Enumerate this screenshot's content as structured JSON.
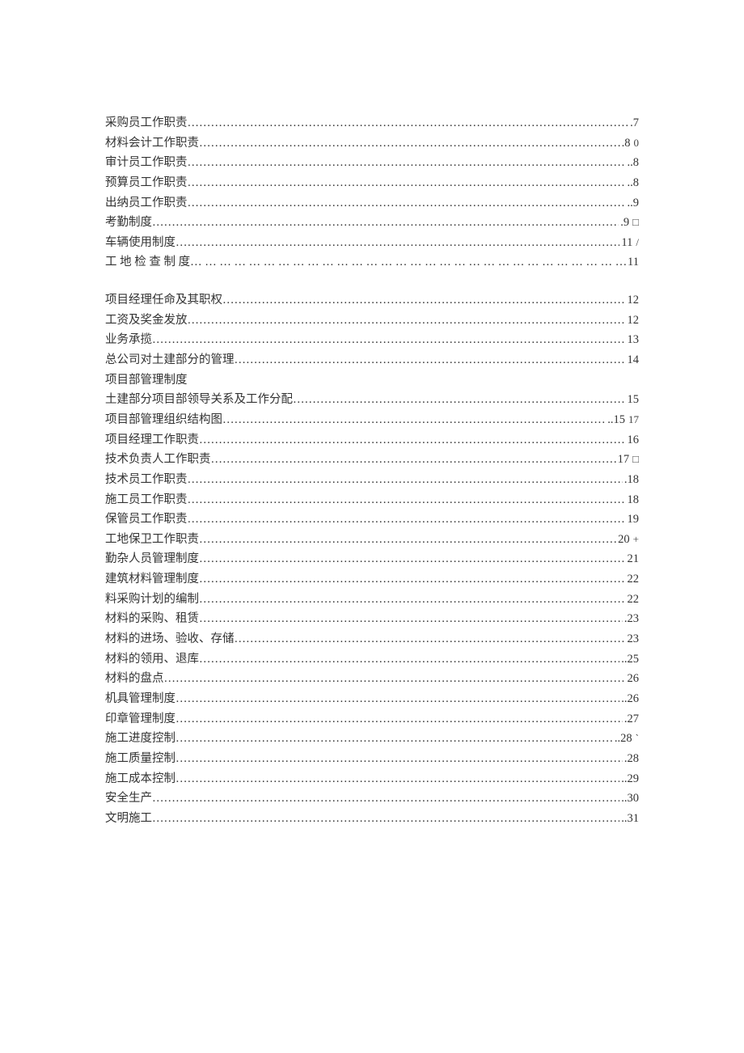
{
  "leader_fill": "……………………………………………………………………………………………………………………………………………………",
  "leader_fill_spaced": "… … … … … … … … … … … … … … … … … … … … … … … … … … … … … … … … … … … … … … … … … … … … … … … … … … … …",
  "block1": [
    {
      "title": "采购员工作职责",
      "page": ".7",
      "trail": ""
    },
    {
      "title": "材料会计工作职责",
      "page": ".8",
      "trail": "0"
    },
    {
      "title": "审计员工作职责",
      "page": "..8",
      "trail": ""
    },
    {
      "title": "预算员工作职责",
      "page": "..8",
      "trail": ""
    },
    {
      "title": "出纳员工作职责",
      "page": "..9",
      "trail": ""
    },
    {
      "title": "考勤制度",
      "page": ".9",
      "trail": "□"
    },
    {
      "title": "车辆使用制度",
      "page": "11",
      "trail": "/"
    },
    {
      "title": "工 地 检 查 制 度",
      "page": "11",
      "trail": "",
      "spaced": true
    }
  ],
  "block2": [
    {
      "title": "项目经理任命及其职权",
      "page": "12",
      "trail": ""
    },
    {
      "title": "工资及奖金发放",
      "page": "12",
      "trail": ""
    },
    {
      "title": "业务承揽",
      "page": "13",
      "trail": ""
    },
    {
      "title": "总公司对土建部分的管理",
      "page": "14",
      "trail": ""
    },
    {
      "title": "项目部管理制度",
      "page": "",
      "trail": "",
      "noleader": true
    },
    {
      "title": "土建部分项目部领导关系及工作分配",
      "page": "15",
      "trail": ""
    },
    {
      "title": "项目部管理组织结构图",
      "page": "..15",
      "trail": "17"
    },
    {
      "title": "项目经理工作职责",
      "page": "16",
      "trail": ""
    },
    {
      "title": "技术负责人工作职责",
      "page": "17",
      "trail": "□"
    },
    {
      "title": "技术员工作职责",
      "page": ".18",
      "trail": ""
    },
    {
      "title": "施工员工作职责",
      "page": "18",
      "trail": ""
    },
    {
      "title": "保管员工作职责",
      "page": "19",
      "trail": ""
    },
    {
      "title": "工地保卫工作职责",
      "page": "20",
      "trail": "+"
    },
    {
      "title": "勤杂人员管理制度",
      "page": "21",
      "trail": ""
    },
    {
      "title": "建筑材料管理制度",
      "page": "22",
      "trail": ""
    },
    {
      "title": "料采购计划的编制",
      "page": "22",
      "trail": ""
    },
    {
      "title": "材料的采购、租赁",
      "page": ".23",
      "trail": ""
    },
    {
      "title": "材料的进场、验收、存储",
      "page": "23",
      "trail": ""
    },
    {
      "title": "材料的领用、退库",
      "page": "..25",
      "trail": ""
    },
    {
      "title": "材料的盘点",
      "page": "26",
      "trail": ""
    },
    {
      "title": "机具管理制度",
      "page": "..26",
      "trail": ""
    },
    {
      "title": "印章管理制度",
      "page": ".27",
      "trail": ""
    },
    {
      "title": "施工进度控制",
      "page": "..28",
      "trail": "`"
    },
    {
      "title": "施工质量控制",
      "page": ".28",
      "trail": ""
    },
    {
      "title": "施工成本控制",
      "page": "..29",
      "trail": ""
    },
    {
      "title": "安全生产",
      "page": "..30",
      "trail": ""
    },
    {
      "title": "文明施工",
      "page": "..31",
      "trail": ""
    }
  ]
}
